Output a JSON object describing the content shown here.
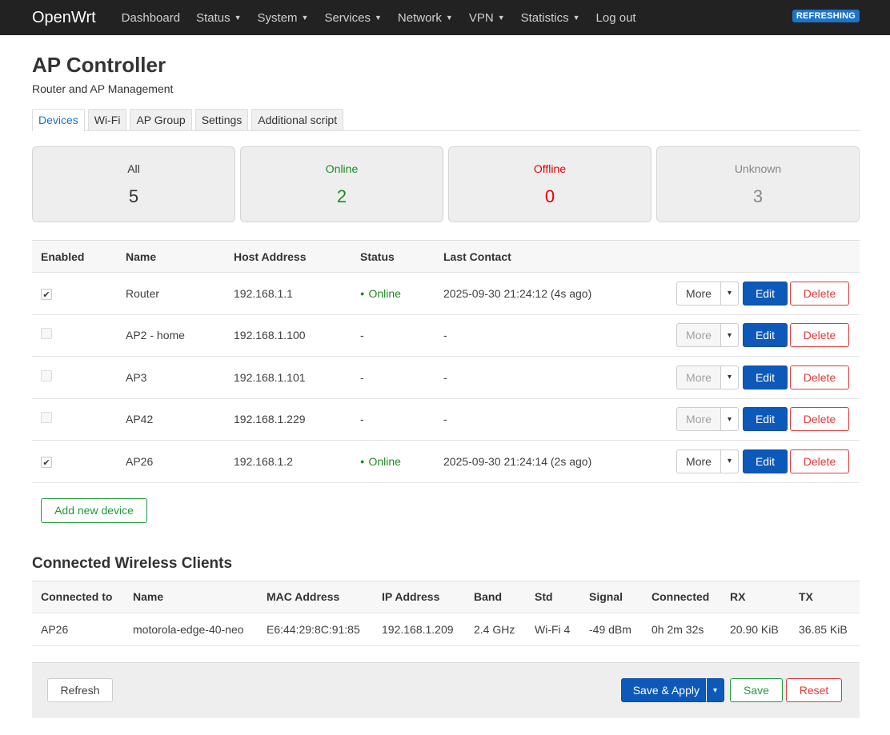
{
  "nav": {
    "brand": "OpenWrt",
    "items": [
      {
        "label": "Dashboard",
        "caret": false
      },
      {
        "label": "Status",
        "caret": true
      },
      {
        "label": "System",
        "caret": true
      },
      {
        "label": "Services",
        "caret": true
      },
      {
        "label": "Network",
        "caret": true
      },
      {
        "label": "VPN",
        "caret": true
      },
      {
        "label": "Statistics",
        "caret": true
      },
      {
        "label": "Log out",
        "caret": false
      }
    ],
    "badge": "REFRESHING"
  },
  "page": {
    "title": "AP Controller",
    "subtitle": "Router and AP Management"
  },
  "tabs": [
    "Devices",
    "Wi-Fi",
    "AP Group",
    "Settings",
    "Additional script"
  ],
  "active_tab": 0,
  "stats": [
    {
      "label": "All",
      "value": "5",
      "cls": "c-all"
    },
    {
      "label": "Online",
      "value": "2",
      "cls": "c-online"
    },
    {
      "label": "Offline",
      "value": "0",
      "cls": "c-offline"
    },
    {
      "label": "Unknown",
      "value": "3",
      "cls": "c-unknown"
    }
  ],
  "devices": {
    "headers": [
      "Enabled",
      "Name",
      "Host Address",
      "Status",
      "Last Contact"
    ],
    "rows": [
      {
        "enabled": true,
        "name": "Router",
        "host": "192.168.1.1",
        "status": "Online",
        "last": "2025-09-30 21:24:12 (4s ago)",
        "more_enabled": true
      },
      {
        "enabled": false,
        "name": "AP2 - home",
        "host": "192.168.1.100",
        "status": "-",
        "last": "-",
        "more_enabled": false
      },
      {
        "enabled": false,
        "name": "AP3",
        "host": "192.168.1.101",
        "status": "-",
        "last": "-",
        "more_enabled": false
      },
      {
        "enabled": false,
        "name": "AP42",
        "host": "192.168.1.229",
        "status": "-",
        "last": "-",
        "more_enabled": false
      },
      {
        "enabled": true,
        "name": "AP26",
        "host": "192.168.1.2",
        "status": "Online",
        "last": "2025-09-30 21:24:14 (2s ago)",
        "more_enabled": true
      }
    ],
    "more_label": "More",
    "dropdown_glyph": "▾",
    "edit_label": "Edit",
    "delete_label": "Delete",
    "online_dot": "●",
    "check_glyph": "✔",
    "add_label": "Add new device"
  },
  "clients": {
    "title": "Connected Wireless Clients",
    "headers": [
      "Connected to",
      "Name",
      "MAC Address",
      "IP Address",
      "Band",
      "Std",
      "Signal",
      "Connected",
      "RX",
      "TX"
    ],
    "rows": [
      [
        "AP26",
        "motorola-edge-40-neo",
        "E6:44:29:8C:91:85",
        "192.168.1.209",
        "2.4 GHz",
        "Wi-Fi 4",
        "-49 dBm",
        "0h 2m 32s",
        "20.90 KiB",
        "36.85 KiB"
      ]
    ]
  },
  "footer": {
    "refresh": "Refresh",
    "save_apply": "Save & Apply",
    "dropdown_glyph": "▾",
    "save": "Save",
    "reset": "Reset"
  },
  "colors": {
    "navbar": "#222222",
    "accent": "#0d59b9",
    "online": "#1e8a1e",
    "offline": "#e00000",
    "add": "#1f9a3a",
    "delete": "#e03a3a"
  }
}
